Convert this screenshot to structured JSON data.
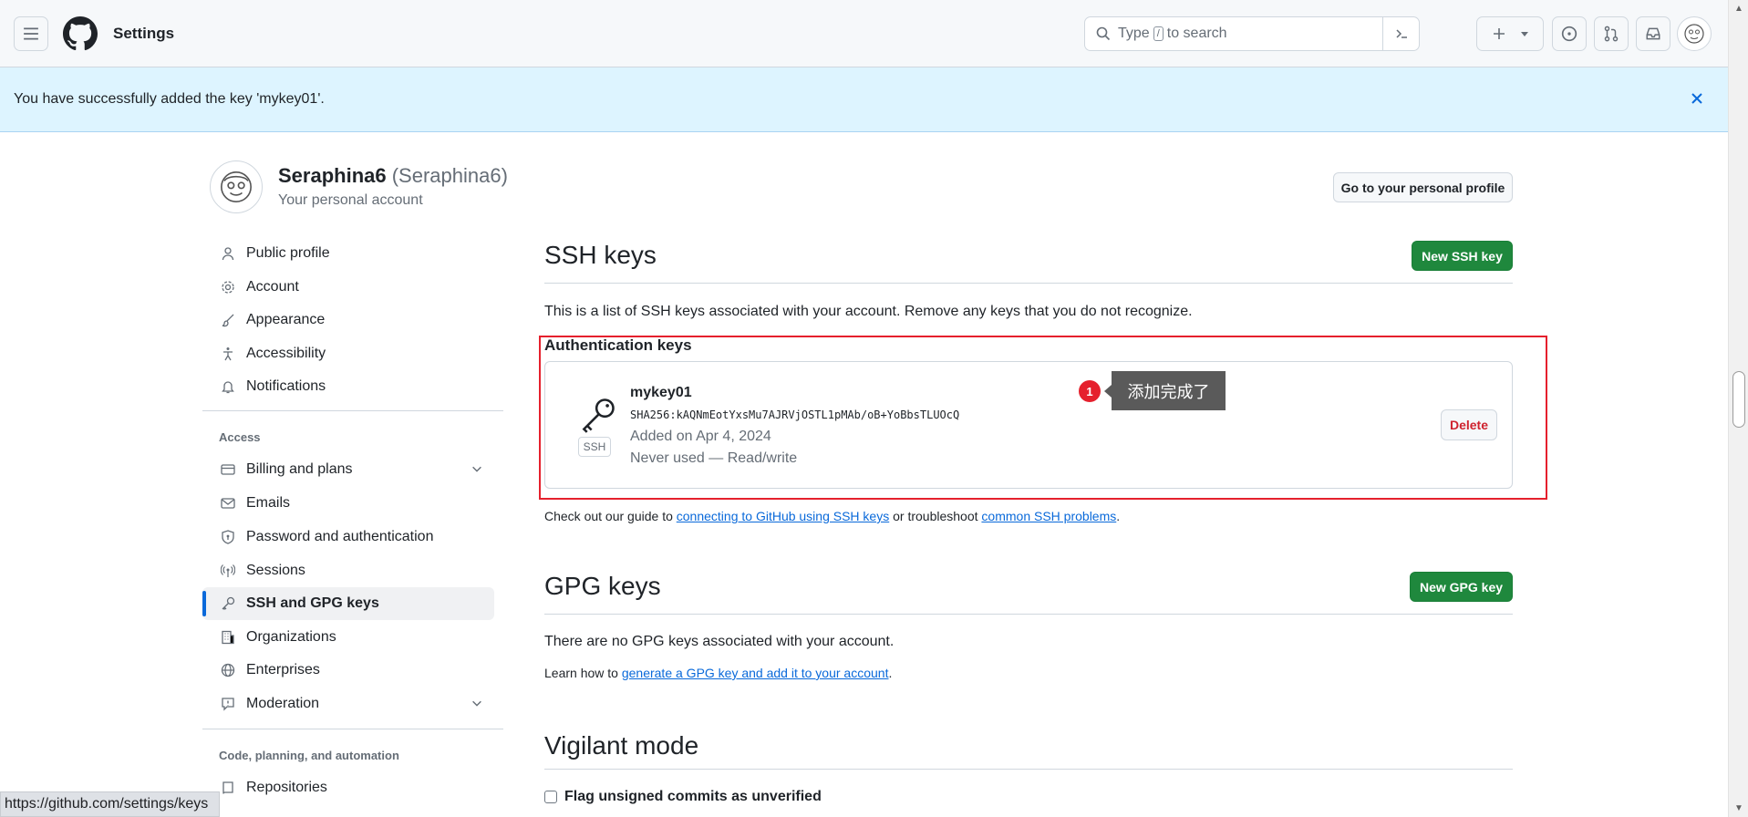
{
  "header": {
    "title": "Settings",
    "search_prefix": "Type",
    "search_slash": "/",
    "search_suffix": "to search"
  },
  "flash": {
    "message": "You have successfully added the key 'mykey01'.",
    "close_symbol": "✕"
  },
  "user": {
    "name": "Seraphina6",
    "login": "(Seraphina6)",
    "subtitle": "Your personal account",
    "profile_button": "Go to your personal profile"
  },
  "sidebar": {
    "items_top": [
      {
        "label": "Public profile",
        "icon": "person-icon"
      },
      {
        "label": "Account",
        "icon": "gear-icon"
      },
      {
        "label": "Appearance",
        "icon": "paintbrush-icon"
      },
      {
        "label": "Accessibility",
        "icon": "accessibility-icon"
      },
      {
        "label": "Notifications",
        "icon": "bell-icon"
      }
    ],
    "group_access": "Access",
    "items_access": [
      {
        "label": "Billing and plans",
        "icon": "credit-card-icon"
      },
      {
        "label": "Emails",
        "icon": "mail-icon"
      },
      {
        "label": "Password and authentication",
        "icon": "shield-lock-icon"
      },
      {
        "label": "Sessions",
        "icon": "broadcast-icon"
      },
      {
        "label": "SSH and GPG keys",
        "icon": "key-icon"
      },
      {
        "label": "Organizations",
        "icon": "organization-icon"
      },
      {
        "label": "Enterprises",
        "icon": "globe-icon"
      },
      {
        "label": "Moderation",
        "icon": "report-icon"
      }
    ],
    "group_code": "Code, planning, and automation",
    "items_code": [
      {
        "label": "Repositories",
        "icon": "repo-icon"
      }
    ]
  },
  "ssh": {
    "title": "SSH keys",
    "new_button": "New SSH key",
    "description": "This is a list of SSH keys associated with your account. Remove any keys that you do not recognize.",
    "auth_title": "Authentication keys",
    "key": {
      "name": "mykey01",
      "fingerprint": "SHA256:kAQNmEotYxsMu7AJRVjOSTL1pMAb/oB+YoBbsTLUOcQ",
      "added": "Added on Apr 4, 2024",
      "usage": "Never used — Read/write",
      "type_label": "SSH",
      "delete_button": "Delete"
    },
    "guide_prefix": "Check out our guide to",
    "guide_link": "connecting to GitHub using SSH keys",
    "guide_middle": "or troubleshoot",
    "guide_link2": "common SSH problems",
    "guide_suffix": "."
  },
  "annotation": {
    "number": "1",
    "text": "添加完成了"
  },
  "gpg": {
    "title": "GPG keys",
    "new_button": "New GPG key",
    "description": "There are no GPG keys associated with your account.",
    "learn_prefix": "Learn how to",
    "learn_link": "generate a GPG key and add it to your account",
    "learn_suffix": "."
  },
  "vigilant": {
    "title": "Vigilant mode",
    "checkbox_label": "Flag unsigned commits as unverified"
  },
  "status_bar": {
    "url": "https://github.com/settings/keys"
  }
}
